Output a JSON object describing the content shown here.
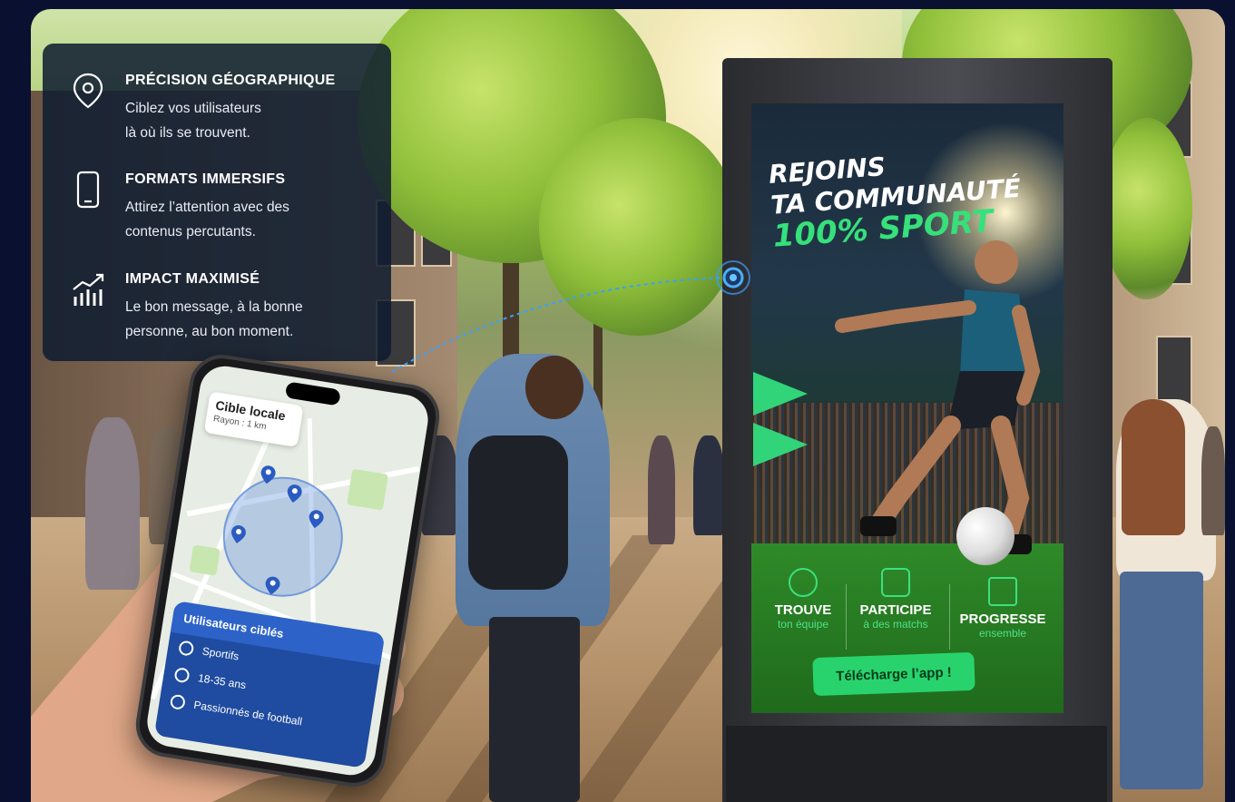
{
  "info_panel": {
    "items": [
      {
        "icon": "location-pin-icon",
        "title": "PRÉCISION GÉOGRAPHIQUE",
        "desc_line1": "Ciblez vos utilisateurs",
        "desc_line2": "là où ils se trouvent."
      },
      {
        "icon": "smartphone-icon",
        "title": "FORMATS IMMERSIFS",
        "desc_line1": "Attirez l’attention avec des",
        "desc_line2": "contenus percutants."
      },
      {
        "icon": "growth-chart-icon",
        "title": "IMPACT MAXIMISÉ",
        "desc_line1": "Le bon message, à la bonne",
        "desc_line2": "personne, au bon moment."
      }
    ]
  },
  "phone": {
    "card_title": "Cible locale",
    "card_subtitle": "Rayon : 1 km",
    "users_header": "Utilisateurs ciblés",
    "users": [
      {
        "icon": "user-icon",
        "label": "Sportifs"
      },
      {
        "icon": "age-icon",
        "label": "18-35 ans"
      },
      {
        "icon": "football-icon",
        "label": "Passionnés de football"
      }
    ]
  },
  "billboard": {
    "headline_1": "REJOINS",
    "headline_2": "TA COMMUNAUTÉ",
    "headline_3": "100% SPORT",
    "features": [
      {
        "icon": "team-icon",
        "title": "TROUVE",
        "sub": "ton équipe"
      },
      {
        "icon": "calendar-icon",
        "title": "PARTICIPE",
        "sub": "à des matchs"
      },
      {
        "icon": "progress-icon",
        "title": "PROGRESSE",
        "sub": "ensemble"
      }
    ],
    "cta": "Télécharge l’app !"
  },
  "colors": {
    "background": "#0a1030",
    "panel": "#0e1c30",
    "accent_green": "#28d36e",
    "accent_blue": "#2d63c8"
  }
}
